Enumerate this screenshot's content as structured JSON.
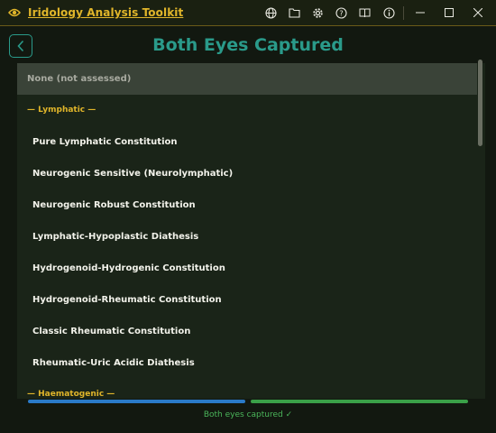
{
  "app": {
    "title": "Iridology Analysis Toolkit",
    "icons": [
      "eye-icon",
      "globe-icon",
      "folder-icon",
      "gear-icon",
      "help-icon",
      "book-icon",
      "info-icon"
    ],
    "window_controls": [
      "minimize",
      "maximize",
      "close"
    ]
  },
  "header": {
    "title": "Both Eyes Captured",
    "back_icon": "chevron-left-icon"
  },
  "list": {
    "selected_label": "None (not assessed)",
    "groups": [
      {
        "title": "— Lymphatic —",
        "items": [
          "Pure Lymphatic Constitution",
          "Neurogenic Sensitive (Neurolymphatic)",
          "Neurogenic Robust Constitution",
          "Lymphatic-Hypoplastic Diathesis",
          "Hydrogenoid-Hydrogenic Constitution",
          "Hydrogenoid-Rheumatic Constitution",
          "Classic Rheumatic Constitution",
          "Rheumatic-Uric Acidic Diathesis"
        ]
      },
      {
        "title": "— Haematogenic —",
        "items": []
      }
    ]
  },
  "progress": {
    "left_eye": 1.0,
    "right_eye": 1.0,
    "left_color": "#2a7ac8",
    "right_color": "#3aa048"
  },
  "status": "Both eyes captured ✓",
  "colors": {
    "accent_gold": "#e0b52a",
    "accent_teal": "#2a9a8a",
    "background": "#121810"
  }
}
